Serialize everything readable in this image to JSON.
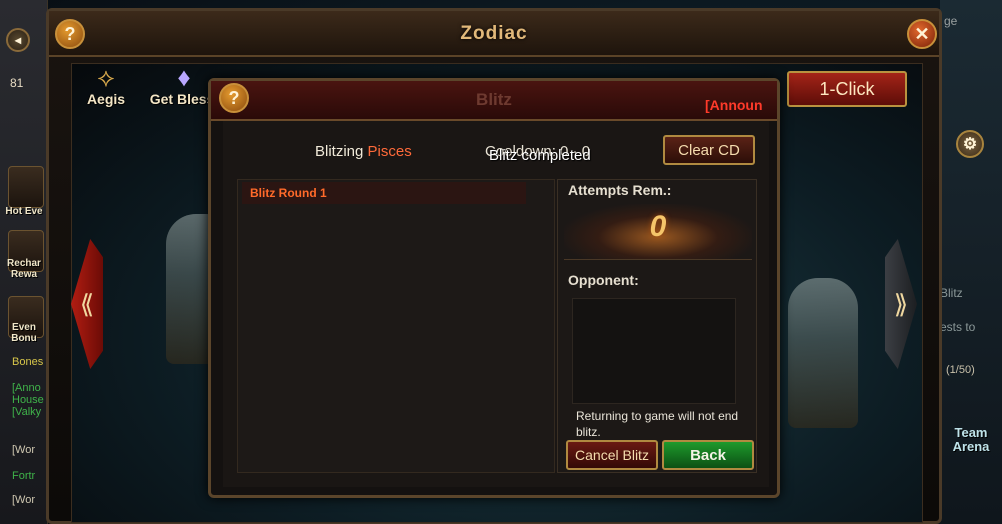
{
  "left_sidebar": {
    "level": "81",
    "items": [
      {
        "label": "Hot Eve"
      },
      {
        "label": "Rechar Rewa"
      },
      {
        "label": "Even Bonu"
      }
    ],
    "chat": [
      {
        "text": "Bones",
        "color": "#d7c64a"
      },
      {
        "text": "[Anno",
        "color": "#3fb34a"
      },
      {
        "text": "House",
        "color": "#3fb34a"
      },
      {
        "text": "[Valky",
        "color": "#3fb34a"
      },
      {
        "text": "[Wor",
        "color": "#cfc7b0"
      },
      {
        "text": "Fortr",
        "color": "#3fb34a"
      },
      {
        "text": "[Wor",
        "color": "#cfc7b0"
      }
    ]
  },
  "right_sidebar": {
    "search_fragment": "ge",
    "blitz_fragment": "Blitz",
    "quests_fragment": "ests to",
    "counter": "(1/50)",
    "team_arena": "Team Arena"
  },
  "zodiac": {
    "title": "Zodiac",
    "emblems": [
      {
        "label": "Aegis"
      },
      {
        "label": "Get Blessi"
      }
    ],
    "one_click_label": "1-Click"
  },
  "blitz": {
    "title": "Blitz",
    "announcement": "[Announ",
    "blitzing_prefix": "Blitzing",
    "zodiac_sign": "Pisces",
    "cooldown_text": "Cooldown: 0 · 0",
    "completed_text": "Blitz completed",
    "clear_cd_label": "Clear CD",
    "rounds": [
      {
        "label": "Blitz Round 1"
      }
    ],
    "attempts_label": "Attempts Rem.:",
    "attempts_value": "0",
    "opponent_label": "Opponent:",
    "note": "Returning to game will not end blitz.",
    "cancel_label": "Cancel Blitz",
    "back_label": "Back"
  }
}
